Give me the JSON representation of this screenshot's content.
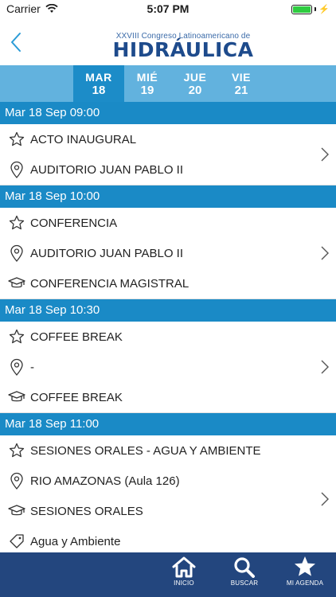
{
  "status_bar": {
    "carrier": "Carrier",
    "time": "5:07 PM"
  },
  "header": {
    "logo_subtitle": "XXVIII Congreso Latinoamericano de",
    "logo_title": "HIDRÁULICA"
  },
  "days": [
    {
      "name": "MAR",
      "num": "18"
    },
    {
      "name": "MIÉ",
      "num": "19"
    },
    {
      "name": "JUE",
      "num": "20"
    },
    {
      "name": "VIE",
      "num": "21"
    }
  ],
  "sections": [
    {
      "header": "Mar 18 Sep 09:00",
      "title": "ACTO INAUGURAL",
      "location": "AUDITORIO JUAN PABLO II"
    },
    {
      "header": "Mar 18 Sep 10:00",
      "title": "CONFERENCIA",
      "location": "AUDITORIO JUAN PABLO II",
      "type": "CONFERENCIA MAGISTRAL"
    },
    {
      "header": "Mar 18 Sep 10:30",
      "title": "COFFEE BREAK",
      "location": "-",
      "type": "COFFEE BREAK"
    },
    {
      "header": "Mar 18 Sep 11:00",
      "title": "SESIONES ORALES - AGUA Y AMBIENTE",
      "location": "RIO AMAZONAS (Aula 126)",
      "type": "SESIONES ORALES",
      "tag": "Agua y Ambiente"
    }
  ],
  "tab_bar": {
    "home": "INICIO",
    "search": "BUSCAR",
    "agenda": "MI AGENDA"
  },
  "colors": {
    "section_header": "#1a8ac6",
    "day_tabs": "#62b2de",
    "active_day": "#1c8cc8",
    "tab_bar": "#23467e"
  }
}
